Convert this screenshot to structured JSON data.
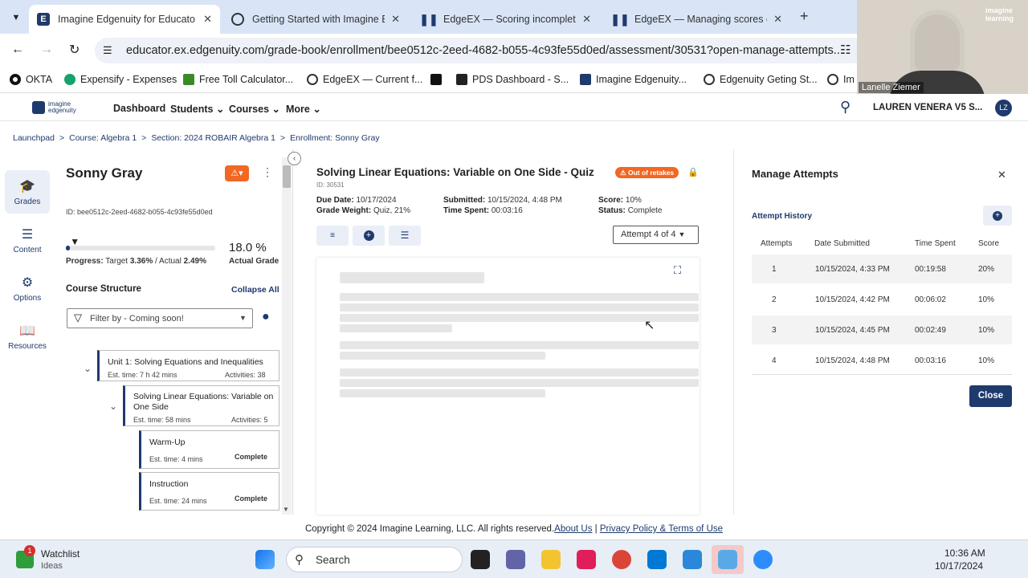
{
  "tabs": [
    {
      "title": "Imagine Edgenuity for Educato",
      "active": true
    },
    {
      "title": "Getting Started with Imagine E",
      "active": false
    },
    {
      "title": "EdgeEX — Scoring incomplete",
      "active": false
    },
    {
      "title": "EdgeEX — Managing scores or",
      "active": false
    }
  ],
  "url": "educator.ex.edgenuity.com/grade-book/enrollment/bee0512c-2eed-4682-b055-4c93fe55d0ed/assessment/30531?open-manage-attempts...",
  "bookmarks": [
    "OKTA",
    "Expensify - Expenses",
    "Free Toll Calculator...",
    "EdgeEX — Current f...",
    "PDS Dashboard - S...",
    "Imagine Edgenuity...",
    "Edgenuity Geting St...",
    "Im"
  ],
  "video": {
    "name": "Lanelle Ziemer",
    "brand": "imagine learning"
  },
  "nav": {
    "logo": "imagine edgenuity",
    "dashboard": "Dashboard",
    "students": "Students",
    "courses": "Courses",
    "more": "More",
    "user": "LAUREN VENERA V5 S...",
    "initials": "LZ"
  },
  "breadcrumbs": [
    "Launchpad",
    "Course: Algebra 1",
    "Section: 2024 ROBAIR Algebra 1",
    "Enrollment: Sonny Gray"
  ],
  "rail": [
    "Grades",
    "Content",
    "Options",
    "Resources"
  ],
  "student": {
    "name": "Sonny Gray",
    "id": "ID: bee0512c-2eed-4682-b055-4c93fe55d0ed",
    "grade": "18.0 %",
    "grade_label": "Actual Grade",
    "progress_label": "Progress:",
    "target_label": "Target",
    "target": "3.36%",
    "actual_label": "/ Actual",
    "actual": "2.49%",
    "progress_fraction": 0.0249,
    "target_fraction": 0.0336,
    "structure": "Course Structure",
    "collapse": "Collapse All",
    "filter": "Filter by - Coming soon!",
    "unit": {
      "title": "Unit 1: Solving Equations and Inequalities",
      "time": "Est. time: 7 h 42 mins",
      "activities": "Activities: 38"
    },
    "lesson": {
      "title": "Solving Linear Equations: Variable on One Side",
      "time": "Est. time: 58 mins",
      "activities": "Activities: 5"
    },
    "items": [
      {
        "title": "Warm-Up",
        "time": "Est. time: 4 mins",
        "status": "Complete"
      },
      {
        "title": "Instruction",
        "time": "Est. time: 24 mins",
        "status": "Complete"
      }
    ]
  },
  "assessment": {
    "title": "Solving Linear Equations: Variable on One Side - Quiz",
    "badge": "Out of retakes",
    "id": "ID: 30531",
    "due_label": "Due Date:",
    "due": "10/17/2024",
    "weight_label": "Grade Weight:",
    "weight": "Quiz, 21%",
    "submitted_label": "Submitted:",
    "submitted": "10/15/2024, 4:48 PM",
    "spent_label": "Time Spent:",
    "spent": "00:03:16",
    "score_label": "Score:",
    "score": "10%",
    "status_label": "Status:",
    "status": "Complete",
    "attempt_select": "Attempt 4 of 4"
  },
  "manage": {
    "title": "Manage Attempts",
    "history": "Attempt History",
    "headers": [
      "Attempts",
      "Date Submitted",
      "Time Spent",
      "Score"
    ],
    "rows": [
      [
        "1",
        "10/15/2024, 4:33 PM",
        "00:19:58",
        "20%"
      ],
      [
        "2",
        "10/15/2024, 4:42 PM",
        "00:06:02",
        "10%"
      ],
      [
        "3",
        "10/15/2024, 4:45 PM",
        "00:02:49",
        "10%"
      ],
      [
        "4",
        "10/15/2024, 4:48 PM",
        "00:03:16",
        "10%"
      ]
    ],
    "close": "Close"
  },
  "footer": {
    "copyright": "Copyright © 2024 Imagine Learning, LLC. All rights reserved.",
    "about": "About Us",
    "privacy": "Privacy Policy & Terms of Use"
  },
  "taskbar": {
    "badge": "1",
    "watchlist": "Watchlist",
    "ideas": "Ideas",
    "search": "Search",
    "time": "10:36 AM",
    "date": "10/17/2024"
  },
  "colors": {
    "navy": "#1f3a6d",
    "accent_orange": "#f26722",
    "alert_red": "#e8532a",
    "tab_bar": "#d9e5f7"
  }
}
